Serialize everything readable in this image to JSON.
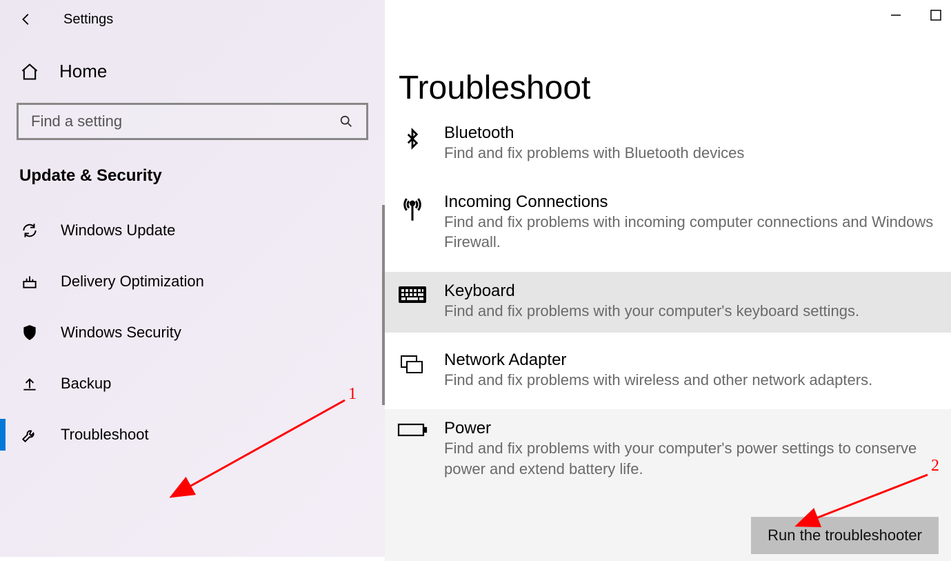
{
  "header": {
    "title": "Settings"
  },
  "sidebar": {
    "home_label": "Home",
    "search_placeholder": "Find a setting",
    "section_label": "Update & Security",
    "items": [
      {
        "id": "windows-update",
        "label": "Windows Update"
      },
      {
        "id": "delivery-optimization",
        "label": "Delivery Optimization"
      },
      {
        "id": "windows-security",
        "label": "Windows Security"
      },
      {
        "id": "backup",
        "label": "Backup"
      },
      {
        "id": "troubleshoot",
        "label": "Troubleshoot",
        "active": true
      }
    ]
  },
  "main": {
    "title": "Troubleshoot",
    "items": [
      {
        "id": "bluetooth",
        "title": "Bluetooth",
        "desc": "Find and fix problems with Bluetooth devices"
      },
      {
        "id": "incoming-connections",
        "title": "Incoming Connections",
        "desc": "Find and fix problems with incoming computer connections and Windows Firewall."
      },
      {
        "id": "keyboard",
        "title": "Keyboard",
        "desc": "Find and fix problems with your computer's keyboard settings.",
        "selected": true
      },
      {
        "id": "network-adapter",
        "title": "Network Adapter",
        "desc": "Find and fix problems with wireless and other network adapters."
      },
      {
        "id": "power",
        "title": "Power",
        "desc": "Find and fix problems with your computer's power settings to conserve power and extend battery life.",
        "expanded": true
      }
    ],
    "run_button_label": "Run the troubleshooter"
  },
  "annotations": {
    "num1": "1",
    "num2": "2"
  }
}
